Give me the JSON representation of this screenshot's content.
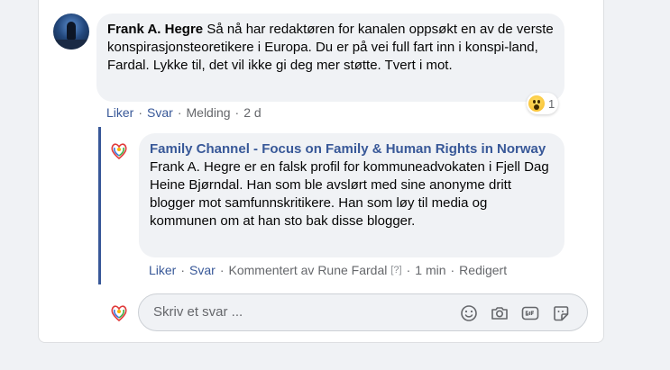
{
  "comment": {
    "author": "Frank A. Hegre",
    "text": "Så nå har redaktøren for kanalen oppsøkt en av de verste konspirasjonsteoretikere i Europa. Du er på vei full fart inn i konspi-land, Fardal. Lykke til, det vil ikke gi deg mer støtte. Tvert i mot.",
    "reaction_count": "1",
    "actions": {
      "like": "Liker",
      "reply": "Svar",
      "message": "Melding",
      "time": "2 d"
    }
  },
  "reply": {
    "author": "Family Channel - Focus on Family & Human Rights in Norway",
    "text": "Frank A. Hegre er en falsk profil for kommuneadvokaten i Fjell Dag Heine Bjørndal. Han som ble avslørt med sine anonyme dritt blogger mot samfunnskritikere. Han som løy til media og kommunen om at han sto bak disse blogger.",
    "actions": {
      "like": "Liker",
      "reply": "Svar",
      "commented_by": "Kommentert av Rune Fardal",
      "help": "[?]",
      "time": "1 min",
      "edited": "Redigert"
    }
  },
  "composer": {
    "placeholder": "Skriv et svar ..."
  },
  "icons": [
    "emoji-icon",
    "camera-icon",
    "gif-icon",
    "sticker-icon",
    "wow-reaction-icon"
  ],
  "colors": {
    "link_blue": "#385898",
    "muted_gray": "#65676b",
    "bubble_gray": "#f0f2f5"
  }
}
